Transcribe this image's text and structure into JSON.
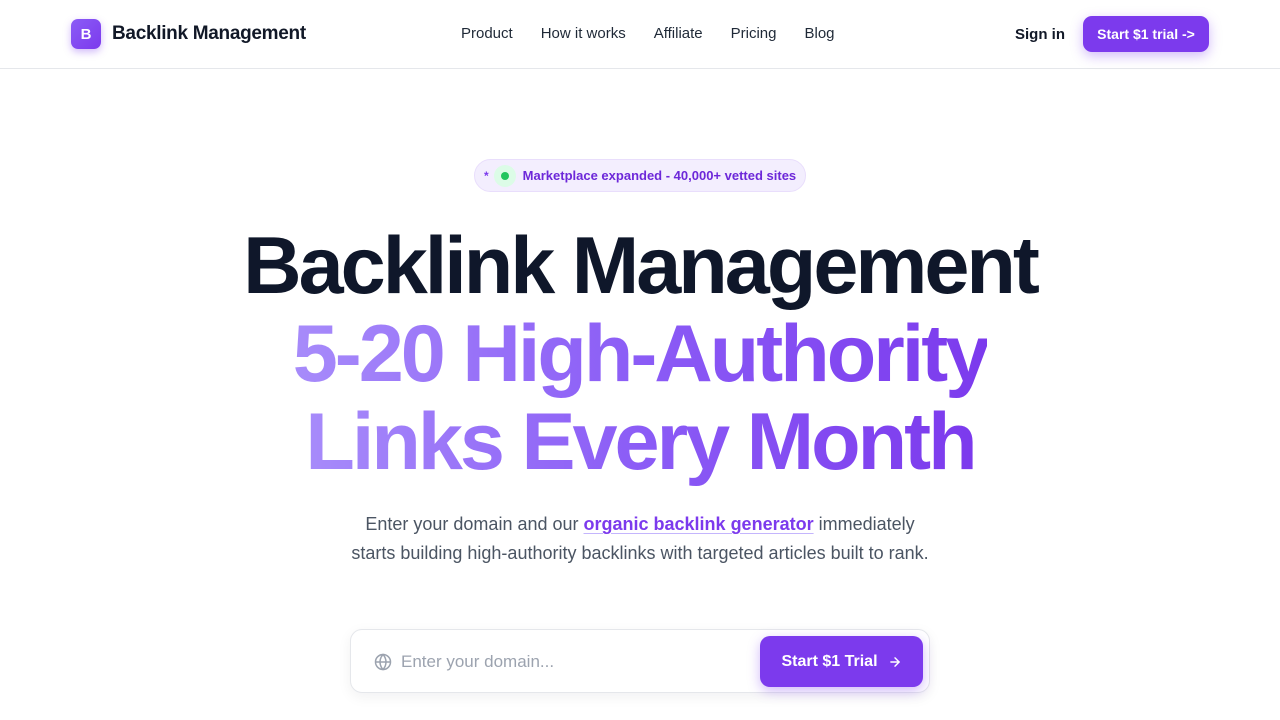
{
  "header": {
    "logo_letter": "B",
    "brand": "Backlink Management",
    "nav": [
      {
        "label": "Product"
      },
      {
        "label": "How it works"
      },
      {
        "label": "Affiliate"
      },
      {
        "label": "Pricing"
      },
      {
        "label": "Blog"
      }
    ],
    "sign_in": "Sign in",
    "cta": "Start $1 trial ->"
  },
  "badge": {
    "star": "*",
    "text": "Marketplace expanded - 40,000+ vetted sites"
  },
  "hero": {
    "line1": "Backlink Management",
    "line2": "5-20 High-Authority",
    "line3": "Links Every Month",
    "sub_before": "Enter your domain and our ",
    "sub_link": "organic backlink generator",
    "sub_after": " immediately starts building high-authority backlinks with targeted articles built to rank."
  },
  "form": {
    "placeholder": "Enter your domain...",
    "button": "Start $1 Trial",
    "icon": "globe-icon",
    "button_icon": "arrow-right-icon"
  },
  "colors": {
    "accent": "#7c3aed",
    "accent_light": "#a78bfa",
    "status_dot": "#22c55e",
    "heading": "#0f172a"
  }
}
